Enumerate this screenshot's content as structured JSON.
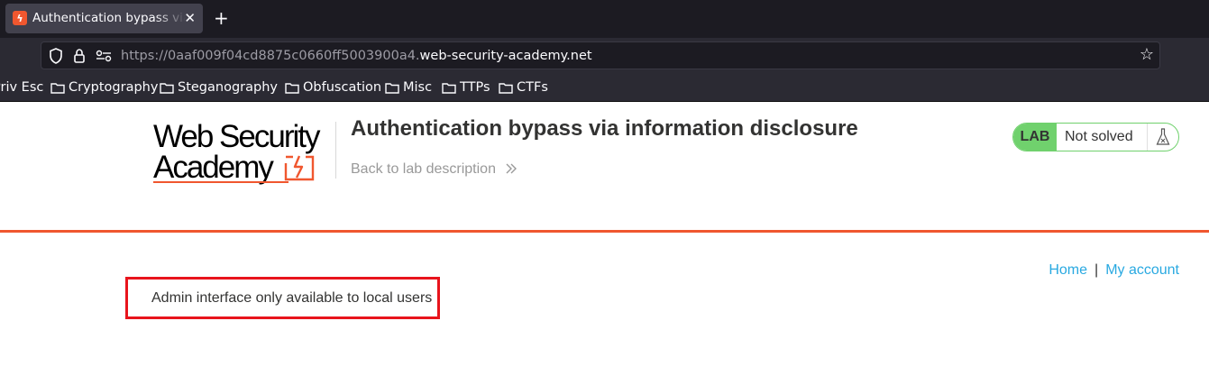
{
  "browser": {
    "tab": {
      "title": "Authentication bypass via information disclosure"
    },
    "url": {
      "subdomain": "https://0aaf009f04cd8875c0660ff5003900a4.",
      "domain": "web-security-academy.net"
    },
    "bookmarks": [
      {
        "label": "Priv Esc"
      },
      {
        "label": "Cryptography"
      },
      {
        "label": "Steganography"
      },
      {
        "label": "Obfuscation"
      },
      {
        "label": "Misc"
      },
      {
        "label": "TTPs"
      },
      {
        "label": "CTFs"
      }
    ]
  },
  "header": {
    "logo": {
      "line1": "Web Security",
      "line2": "Academy"
    },
    "lab_title": "Authentication bypass via information disclosure",
    "back_link": "Back to lab description",
    "status": {
      "badge": "LAB",
      "state": "Not solved"
    }
  },
  "nav": {
    "home": "Home",
    "separator": "|",
    "account": "My account"
  },
  "main": {
    "message": "Admin interface only available to local users"
  },
  "colors": {
    "accent": "#f0572f",
    "link": "#29a9e1",
    "lab_green": "#70d16d",
    "highlight": "#e8141c"
  }
}
